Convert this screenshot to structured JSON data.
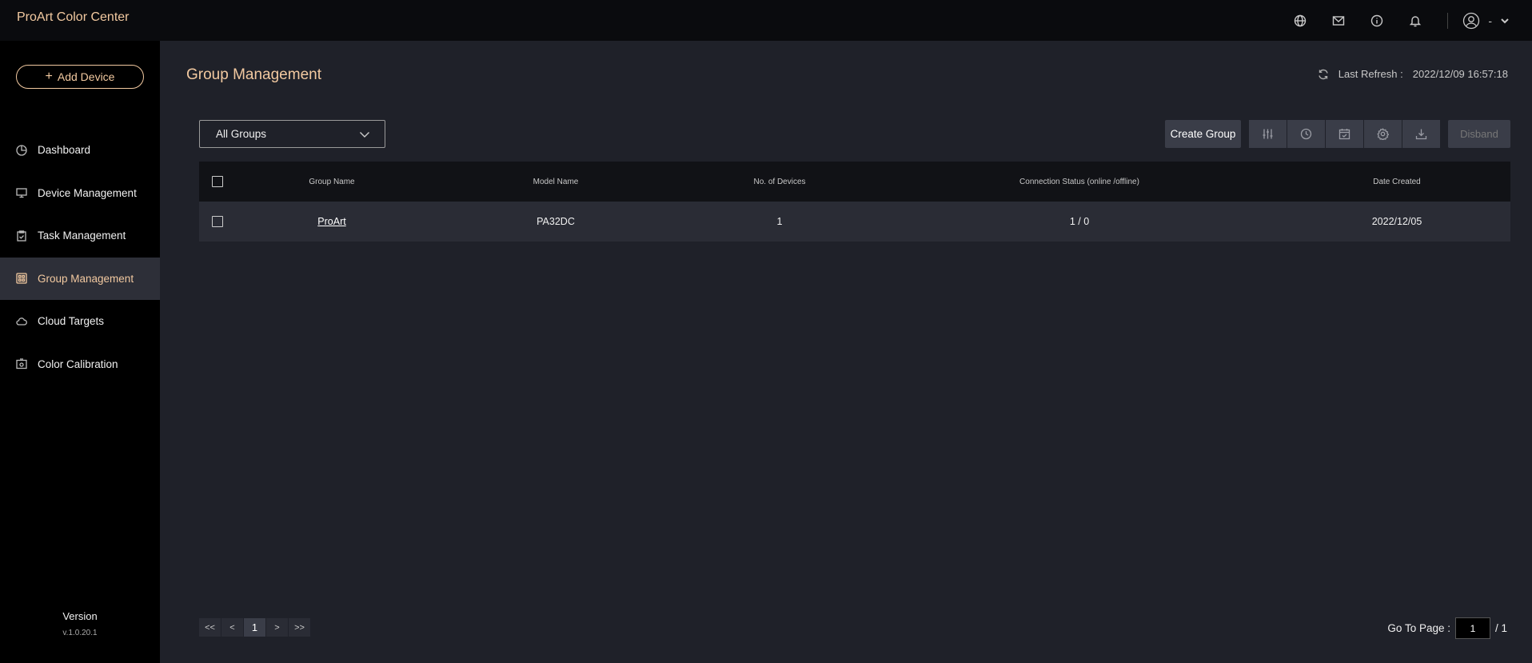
{
  "app": {
    "title": "ProArt Color Center"
  },
  "header": {
    "icons": [
      "globe-icon",
      "mail-icon",
      "info-icon",
      "bell-icon"
    ],
    "user_label": "-"
  },
  "sidebar": {
    "add_device": "Add Device",
    "items": [
      {
        "label": "Dashboard",
        "icon": "dashboard-icon"
      },
      {
        "label": "Device Management",
        "icon": "monitor-icon"
      },
      {
        "label": "Task Management",
        "icon": "clipboard-icon"
      },
      {
        "label": "Group Management",
        "icon": "grid-icon",
        "active": true
      },
      {
        "label": "Cloud Targets",
        "icon": "cloud-icon"
      },
      {
        "label": "Color Calibration",
        "icon": "calibration-icon"
      }
    ],
    "version_label": "Version",
    "version_number": "v.1.0.20.1"
  },
  "main": {
    "title": "Group Management",
    "last_refresh_label": "Last Refresh :",
    "last_refresh_value": "2022/12/09 16:57:18",
    "group_filter": "All Groups",
    "create_group": "Create Group",
    "disband": "Disband",
    "table": {
      "columns": [
        "Group Name",
        "Model Name",
        "No. of Devices",
        "Connection Status (online /offline)",
        "Date Created"
      ],
      "rows": [
        {
          "group_name": "ProArt",
          "model_name": "PA32DC",
          "devices": "1",
          "connection": "1 / 0",
          "date": "2022/12/05"
        }
      ]
    },
    "pager": {
      "first": "<<",
      "prev": "<",
      "current": "1",
      "next": ">",
      "last": ">>"
    },
    "goto_label": "Go To Page :",
    "goto_value": "1",
    "total_pages": "/ 1"
  },
  "colors": {
    "accent": "#f2c9a0",
    "sidebar_bg": "#000000",
    "main_bg": "#1f2129"
  }
}
